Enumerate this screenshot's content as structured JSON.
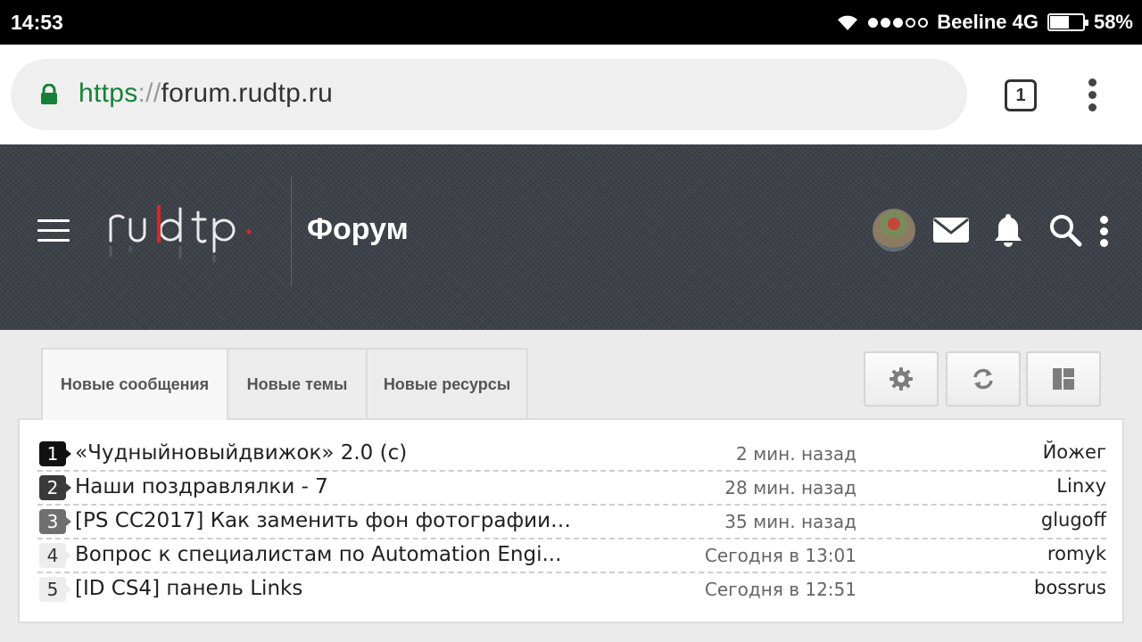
{
  "status_bar": {
    "time": "14:53",
    "carrier": "Beeline 4G",
    "battery": "58%",
    "battery_level": 0.58,
    "signal_icon": "cellular-signal-dots",
    "wifi_icon": "wifi-icon"
  },
  "browser": {
    "url_scheme": "https",
    "url_sep": "://",
    "url_host": "forum.rudtp.ru",
    "tab_count": "1"
  },
  "site_header": {
    "title": "Форум",
    "logo_text": "ru|dtp."
  },
  "tabs": [
    {
      "label": "Новые сообщения",
      "active": true
    },
    {
      "label": "Новые темы",
      "active": false
    },
    {
      "label": "Новые ресурсы",
      "active": false
    }
  ],
  "tool_buttons": [
    "settings-icon",
    "refresh-icon",
    "layout-icon"
  ],
  "threads": [
    {
      "num": "1",
      "title": "«Чудныйновыйдвижок» 2.0 (с)",
      "time": "2 мин. назад",
      "author": "Йожег"
    },
    {
      "num": "2",
      "title": "Наши поздравлялки - 7",
      "time": "28 мин. назад",
      "author": "Linxy"
    },
    {
      "num": "3",
      "title": "[PS CC2017]  Как заменить фон фотографии ...",
      "time": "35 мин. назад",
      "author": "glugoff"
    },
    {
      "num": "4",
      "title": "Вопрос к специалистам по Automation Engi...",
      "time": "Сегодня в 13:01",
      "author": "romyk"
    },
    {
      "num": "5",
      "title": "[ID CS4]  панель Links",
      "time": "Сегодня в 12:51",
      "author": "bossrus"
    }
  ]
}
